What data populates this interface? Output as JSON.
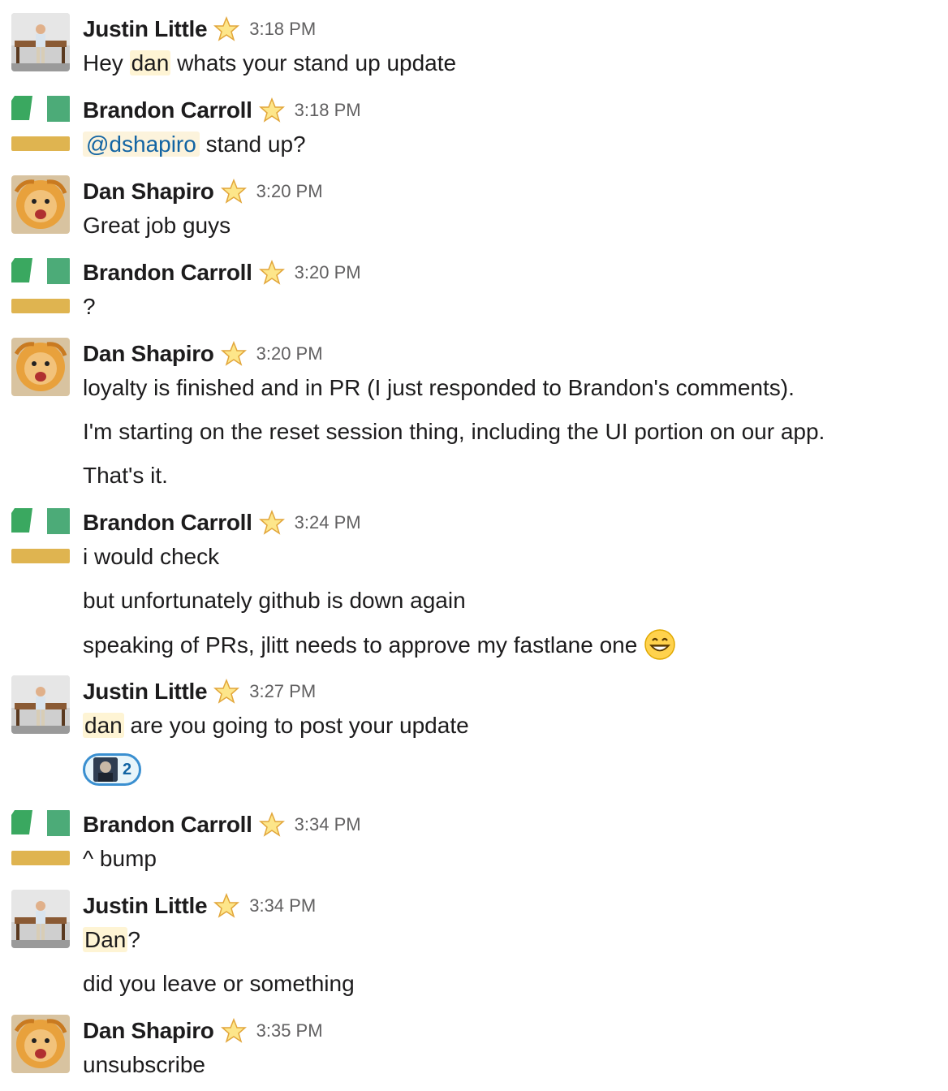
{
  "messages": [
    {
      "author": "Justin Little",
      "time": "3:18 PM",
      "avatar": "justin-avatar",
      "lines": [
        [
          "Hey ",
          {
            "hl": "dan"
          },
          " whats your stand up update"
        ]
      ]
    },
    {
      "author": "Brandon Carroll",
      "time": "3:18 PM",
      "avatar": "brandon-avatar",
      "lines": [
        [
          {
            "mention": "@dshapiro"
          },
          " stand up?"
        ]
      ]
    },
    {
      "author": "Dan Shapiro",
      "time": "3:20 PM",
      "avatar": "dan-avatar",
      "lines": [
        [
          "Great job guys"
        ]
      ]
    },
    {
      "author": "Brandon Carroll",
      "time": "3:20 PM",
      "avatar": "brandon-avatar",
      "lines": [
        [
          "?"
        ]
      ]
    },
    {
      "author": "Dan Shapiro",
      "time": "3:20 PM",
      "avatar": "dan-avatar",
      "lines": [
        [
          "loyalty is finished and in PR (I just responded to Brandon's comments)."
        ],
        [
          "I'm starting on the reset session thing, including the UI portion on our app."
        ],
        [
          "That's it."
        ]
      ]
    },
    {
      "author": "Brandon Carroll",
      "time": "3:24 PM",
      "avatar": "brandon-avatar",
      "lines": [
        [
          "i would check"
        ],
        [
          "but unfortunately github is down again"
        ],
        [
          "speaking of PRs, jlitt needs to approve my fastlane one",
          {
            "emoji": "grinning-face-emoji"
          }
        ]
      ]
    },
    {
      "author": "Justin Little",
      "time": "3:27 PM",
      "avatar": "justin-avatar",
      "lines": [
        [
          {
            "hl": "dan"
          },
          " are you going to post your update"
        ]
      ],
      "reaction": {
        "count": "2"
      }
    },
    {
      "author": "Brandon Carroll",
      "time": "3:34 PM",
      "avatar": "brandon-avatar",
      "lines": [
        [
          "^ bump"
        ]
      ]
    },
    {
      "author": "Justin Little",
      "time": "3:34 PM",
      "avatar": "justin-avatar",
      "lines": [
        [
          {
            "hl": "Dan"
          },
          "?"
        ],
        [
          "did you leave or something"
        ]
      ]
    },
    {
      "author": "Dan Shapiro",
      "time": "3:35 PM",
      "avatar": "dan-avatar",
      "lines": [
        [
          "unsubscribe"
        ]
      ]
    }
  ],
  "colors": {
    "mention": "#1264a3",
    "highlight": "#fef4d4",
    "timestamp": "#616061",
    "reaction_border": "#3a8fd0"
  },
  "icons": {
    "status": "star-icon"
  }
}
